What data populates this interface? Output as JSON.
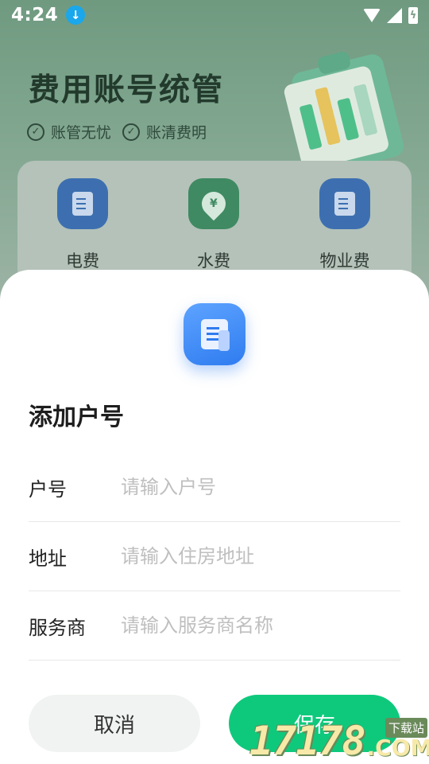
{
  "status_bar": {
    "time": "4:24",
    "download_icon": "download-icon",
    "wifi_icon": "wifi-icon",
    "signal_icon": "signal-icon",
    "battery_icon": "battery-charging-icon"
  },
  "hero": {
    "title": "费用账号统管",
    "tags": [
      "账管无忧",
      "账清费明"
    ]
  },
  "categories": [
    {
      "label": "电费",
      "icon": "document-icon"
    },
    {
      "label": "水费",
      "icon": "water-drop-icon"
    },
    {
      "label": "物业费",
      "icon": "document-icon"
    }
  ],
  "sheet": {
    "title": "添加户号",
    "fields": [
      {
        "label": "户号",
        "placeholder": "请输入户号",
        "value": ""
      },
      {
        "label": "地址",
        "placeholder": "请输入住房地址",
        "value": ""
      },
      {
        "label": "服务商",
        "placeholder": "请输入服务商名称",
        "value": ""
      }
    ],
    "cancel_label": "取消",
    "save_label": "保存"
  },
  "watermark": {
    "number": "17178",
    "dot": ".COM",
    "site": "下载站"
  },
  "colors": {
    "accent": "#0ec97c",
    "icon_blue": "#2f7cf0",
    "cancel_bg": "#f0f3f1"
  }
}
